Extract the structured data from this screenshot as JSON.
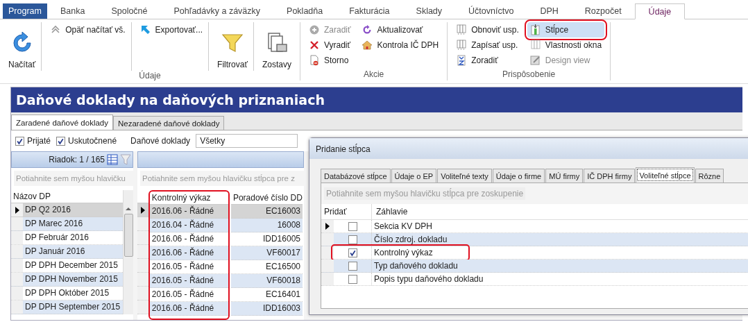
{
  "ribbon_tabs": [
    {
      "label": "Program",
      "kind": "file",
      "selected": false
    },
    {
      "label": "Banka",
      "kind": "tab",
      "selected": false
    },
    {
      "label": "Spoločné",
      "kind": "tab",
      "selected": false
    },
    {
      "label": "Pohľadávky a záväzky",
      "kind": "tab",
      "selected": false
    },
    {
      "label": "Pokladňa",
      "kind": "tab",
      "selected": false
    },
    {
      "label": "Fakturácia",
      "kind": "tab",
      "selected": false
    },
    {
      "label": "Sklady",
      "kind": "tab",
      "selected": false
    },
    {
      "label": "Účtovníctvo",
      "kind": "tab",
      "selected": false
    },
    {
      "label": "DPH",
      "kind": "tab",
      "selected": false
    },
    {
      "label": "Rozpočet",
      "kind": "tab",
      "selected": false
    },
    {
      "label": "Údaje",
      "kind": "tab",
      "selected": true
    }
  ],
  "ribbon_groups": [
    {
      "label": "Údaje",
      "dividers": true,
      "columns": [
        [
          {
            "label": "Načítať",
            "kind": "large",
            "disabled": false,
            "pressed": false,
            "annotated": false
          }
        ],
        [
          {
            "label": "Opäť načítať vš.",
            "kind": "small",
            "disabled": false,
            "pressed": false,
            "annotated": false
          }
        ],
        [
          {
            "label": "Exportovať...",
            "kind": "small",
            "disabled": false,
            "pressed": false,
            "annotated": false
          }
        ],
        [
          {
            "label": "Filtrovať",
            "kind": "large",
            "disabled": false,
            "pressed": false,
            "annotated": false
          }
        ],
        [
          {
            "label": "Zostavy",
            "kind": "large",
            "disabled": false,
            "pressed": false,
            "annotated": false
          }
        ]
      ]
    },
    {
      "label": "Akcie",
      "dividers": false,
      "columns": [
        [
          {
            "label": "Zaradiť",
            "kind": "small",
            "disabled": true,
            "pressed": false,
            "annotated": false
          },
          {
            "label": "Vyradiť",
            "kind": "small",
            "disabled": false,
            "pressed": false,
            "annotated": false
          },
          {
            "label": "Storno",
            "kind": "small",
            "disabled": false,
            "pressed": false,
            "annotated": false
          }
        ],
        [
          {
            "label": "Aktualizovať",
            "kind": "small",
            "disabled": false,
            "pressed": false,
            "annotated": false
          },
          {
            "label": "Kontrola IČ DPH",
            "kind": "small",
            "disabled": false,
            "pressed": false,
            "annotated": false
          }
        ]
      ]
    },
    {
      "label": "Prispôsobenie",
      "dividers": false,
      "columns": [
        [
          {
            "label": "Obnoviť usp.",
            "kind": "small",
            "disabled": false,
            "pressed": false,
            "annotated": false
          },
          {
            "label": "Zapísať usp.",
            "kind": "small",
            "disabled": false,
            "pressed": false,
            "annotated": false
          },
          {
            "label": "Zoradiť",
            "kind": "small",
            "disabled": false,
            "pressed": false,
            "annotated": false
          }
        ],
        [
          {
            "label": "Stĺpce",
            "kind": "small",
            "disabled": false,
            "pressed": true,
            "annotated": true
          },
          {
            "label": "Vlastnosti okna",
            "kind": "small",
            "disabled": false,
            "pressed": false,
            "annotated": false
          },
          {
            "label": "Design view",
            "kind": "small",
            "disabled": true,
            "pressed": false,
            "annotated": false
          }
        ]
      ]
    }
  ],
  "window": {
    "title": "Daňové doklady na daňových priznaniach",
    "tabs": [
      {
        "label": "Zaradené daňové doklady",
        "selected": true
      },
      {
        "label": "Nezaradené daňové doklady",
        "selected": false
      }
    ],
    "checkboxes": [
      {
        "label": "Prijaté",
        "checked": true
      },
      {
        "label": "Uskutočnené",
        "checked": true
      }
    ],
    "combo_label": "Daňové doklady",
    "combo_value": "Všetky",
    "left_grid": {
      "row_counter": "Riadok: 1 / 165",
      "group_hint": "Potiahnite sem myšou hlavičku",
      "column": "Názov DP",
      "rows": [
        {
          "cell": "DP Q2 2016",
          "selected": true
        },
        {
          "cell": "DP Marec 2016",
          "selected": false
        },
        {
          "cell": "DP Február 2016",
          "selected": false
        },
        {
          "cell": "DP Január 2016",
          "selected": false
        },
        {
          "cell": "DP DPH December 2015",
          "selected": false
        },
        {
          "cell": "DP DPH November 2015",
          "selected": false
        },
        {
          "cell": "DP DPH Október 2015",
          "selected": false
        },
        {
          "cell": "DP DPH September 2015",
          "selected": false
        }
      ]
    },
    "right_grid": {
      "group_hint": "Potiahnite sem myšou hlavičku stĺpca pre z",
      "columns": [
        {
          "label": "Kontrolný výkaz",
          "annotated": true
        },
        {
          "label": "Poradové číslo DD",
          "annotated": false
        }
      ],
      "rows": [
        {
          "cells": [
            "2016.06 - Řádné",
            "EC16003"
          ],
          "selected": true
        },
        {
          "cells": [
            "2016.04 - Řádné",
            "16008"
          ],
          "selected": false
        },
        {
          "cells": [
            "2016.06 - Řádné",
            "IDD16005"
          ],
          "selected": false
        },
        {
          "cells": [
            "2016.06 - Řádné",
            "VF60017"
          ],
          "selected": false
        },
        {
          "cells": [
            "2016.05 - Řádné",
            "EC16500"
          ],
          "selected": false
        },
        {
          "cells": [
            "2016.05 - Řádné",
            "VF60018"
          ],
          "selected": false
        },
        {
          "cells": [
            "2016.05 - Řádné",
            "EC16401"
          ],
          "selected": false
        },
        {
          "cells": [
            "2016.06 - Řádné",
            "IDD16003"
          ],
          "selected": false
        }
      ]
    }
  },
  "dialog": {
    "title": "Pridanie stĺpca",
    "tabs": [
      {
        "label": "Databázové stĺpce",
        "selected": false
      },
      {
        "label": "Údaje o EP",
        "selected": false
      },
      {
        "label": "Voliteľné texty",
        "selected": false
      },
      {
        "label": "Údaje o firme",
        "selected": false
      },
      {
        "label": "MÚ firmy",
        "selected": false
      },
      {
        "label": "IČ DPH firmy",
        "selected": false
      },
      {
        "label": "Voliteľné stĺpce",
        "selected": true
      },
      {
        "label": "Rôzne",
        "selected": false
      }
    ],
    "group_hint": "Potiahnite sem myšou hlavičku stĺpca pre zoskupenie",
    "columns": [
      "Pridať",
      "Záhlavie"
    ],
    "rows": [
      {
        "label": "Sekcia KV DPH",
        "checked": false,
        "selected": true,
        "annotated": false
      },
      {
        "label": "Číslo zdroj. dokladu",
        "checked": false,
        "selected": false,
        "annotated": false
      },
      {
        "label": "Kontrolný výkaz",
        "checked": true,
        "selected": false,
        "annotated": true
      },
      {
        "label": "Typ daňového dokladu",
        "checked": false,
        "selected": false,
        "annotated": false
      },
      {
        "label": "Popis typu daňového dokladu",
        "checked": false,
        "selected": false,
        "annotated": false
      }
    ]
  }
}
